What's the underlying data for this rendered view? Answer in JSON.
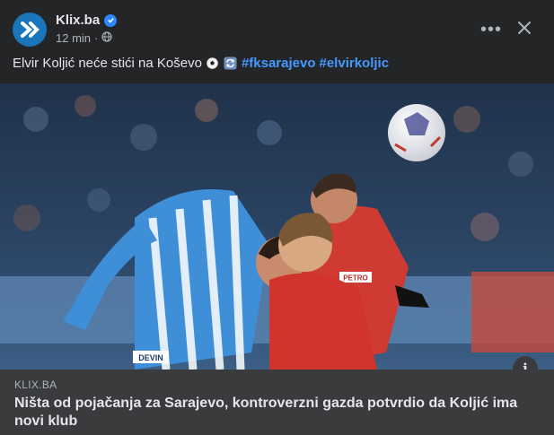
{
  "header": {
    "page_name": "Klix.ba",
    "time": "12 min",
    "dot": "·",
    "more_label": "•••"
  },
  "post": {
    "text": "Elvir Koljić neće stići na Koševo",
    "hashtags": [
      "#fksarajevo",
      "#elvirkoljic"
    ]
  },
  "photo": {
    "shirt_sponsor_blue": "DEVIN",
    "shirt_sponsor_red": "PETRO"
  },
  "link_preview": {
    "domain": "KLIX.BA",
    "headline": "Ništa od pojačanja za Sarajevo, kontroverzni gazda potvrdio da Koljić ima novi klub"
  },
  "colors": {
    "background": "#242526",
    "link_box": "#3a3b3c",
    "hashtag": "#4599ff",
    "verified": "#2d88ff",
    "brand": "#1b75bb"
  }
}
